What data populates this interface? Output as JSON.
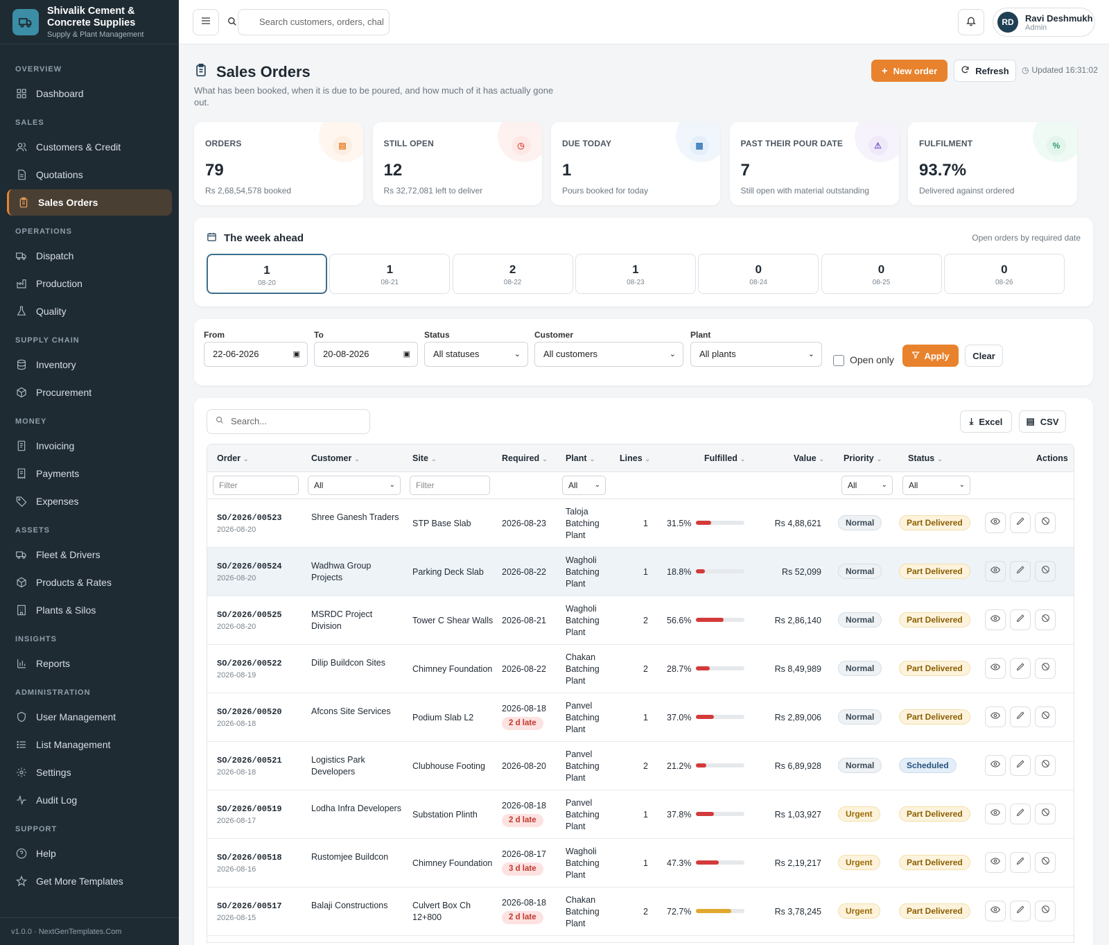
{
  "brand": {
    "title_line1": "Shivalik Cement &",
    "title_line2": "Concrete Supplies",
    "subtitle": "Supply & Plant Management"
  },
  "nav": {
    "sections": [
      {
        "label": "OVERVIEW",
        "items": [
          {
            "label": "Dashboard",
            "icon": "grid-icon"
          }
        ]
      },
      {
        "label": "SALES",
        "items": [
          {
            "label": "Customers & Credit",
            "icon": "users-icon"
          },
          {
            "label": "Quotations",
            "icon": "file-icon"
          },
          {
            "label": "Sales Orders",
            "icon": "clipboard-icon",
            "active": true
          }
        ]
      },
      {
        "label": "OPERATIONS",
        "items": [
          {
            "label": "Dispatch",
            "icon": "truck-icon"
          },
          {
            "label": "Production",
            "icon": "factory-icon"
          },
          {
            "label": "Quality",
            "icon": "flask-icon"
          }
        ]
      },
      {
        "label": "SUPPLY CHAIN",
        "items": [
          {
            "label": "Inventory",
            "icon": "database-icon"
          },
          {
            "label": "Procurement",
            "icon": "box-icon"
          }
        ]
      },
      {
        "label": "MONEY",
        "items": [
          {
            "label": "Invoicing",
            "icon": "invoice-icon"
          },
          {
            "label": "Payments",
            "icon": "receipt-icon"
          },
          {
            "label": "Expenses",
            "icon": "tag-icon"
          }
        ]
      },
      {
        "label": "ASSETS",
        "items": [
          {
            "label": "Fleet & Drivers",
            "icon": "truck-icon"
          },
          {
            "label": "Products & Rates",
            "icon": "box-icon"
          },
          {
            "label": "Plants & Silos",
            "icon": "building-icon"
          }
        ]
      },
      {
        "label": "INSIGHTS",
        "items": [
          {
            "label": "Reports",
            "icon": "bar-chart-icon"
          }
        ]
      },
      {
        "label": "ADMINISTRATION",
        "items": [
          {
            "label": "User Management",
            "icon": "shield-icon"
          },
          {
            "label": "List Management",
            "icon": "list-icon"
          },
          {
            "label": "Settings",
            "icon": "gear-icon"
          },
          {
            "label": "Audit Log",
            "icon": "activity-icon"
          }
        ]
      },
      {
        "label": "SUPPORT",
        "items": [
          {
            "label": "Help",
            "icon": "help-icon"
          },
          {
            "label": "Get More Templates",
            "icon": "star-icon"
          }
        ]
      }
    ],
    "version": "v1.0.0 · NextGenTemplates.Com"
  },
  "topbar": {
    "search_placeholder": "Search customers, orders, chal",
    "user": {
      "initials": "RD",
      "name": "Ravi Deshmukh",
      "role": "Admin"
    }
  },
  "header": {
    "title": "Sales Orders",
    "subtitle": "What has been booked, when it is due to be poured, and how much of it has actually gone out.",
    "new_order": "New order",
    "refresh": "Refresh",
    "updated": "Updated 16:31:02"
  },
  "kpis": [
    {
      "label": "ORDERS",
      "value": "79",
      "note": "Rs 2,68,54,578 booked",
      "color": "#e8822c",
      "bg": "#fdeee2",
      "icon": "clipboard-icon"
    },
    {
      "label": "STILL OPEN",
      "value": "12",
      "note": "Rs 32,72,081 left to deliver",
      "color": "#e0554b",
      "bg": "#fde8e6",
      "icon": "clock-icon"
    },
    {
      "label": "DUE TODAY",
      "value": "1",
      "note": "Pours booked for today",
      "color": "#3c7dbb",
      "bg": "#e5effa",
      "icon": "calendar-icon"
    },
    {
      "label": "PAST THEIR POUR DATE",
      "value": "7",
      "note": "Still open with material outstanding",
      "color": "#7b58c4",
      "bg": "#efe9fa",
      "icon": "alert-icon"
    },
    {
      "label": "FULFILMENT",
      "value": "93.7%",
      "note": "Delivered against ordered",
      "color": "#2e9e6a",
      "bg": "#e3f5ec",
      "icon": "percent-icon"
    }
  ],
  "week": {
    "title": "The week ahead",
    "note": "Open orders by required date",
    "days": [
      {
        "count": "1",
        "date": "08-20",
        "selected": true
      },
      {
        "count": "1",
        "date": "08-21"
      },
      {
        "count": "2",
        "date": "08-22"
      },
      {
        "count": "1",
        "date": "08-23"
      },
      {
        "count": "0",
        "date": "08-24"
      },
      {
        "count": "0",
        "date": "08-25"
      },
      {
        "count": "0",
        "date": "08-26"
      }
    ]
  },
  "filters": {
    "from_label": "From",
    "from": "22-06-2026",
    "to_label": "To",
    "to": "20-08-2026",
    "status_label": "Status",
    "status": "All statuses",
    "customer_label": "Customer",
    "customer": "All customers",
    "plant_label": "Plant",
    "plant": "All plants",
    "open_only": "Open only",
    "apply": "Apply",
    "clear": "Clear"
  },
  "table": {
    "search_placeholder": "Search...",
    "excel": "Excel",
    "csv": "CSV",
    "columns": {
      "order": "Order",
      "customer": "Customer",
      "site": "Site",
      "required": "Required",
      "plant": "Plant",
      "lines": "Lines",
      "fulfilled": "Fulfilled",
      "value": "Value",
      "priority": "Priority",
      "status": "Status",
      "actions": "Actions"
    },
    "filter_row": {
      "order": "Filter",
      "customer": "All",
      "site": "Filter",
      "plant": "All",
      "priority": "All",
      "status": "All"
    },
    "rows": [
      {
        "order": "SO/2026/00523",
        "date": "2026-08-20",
        "customer": "Shree Ganesh Traders",
        "site": "STP Base Slab",
        "required": "2026-08-23",
        "late": "",
        "plant": "Taloja Batching Plant",
        "lines": "1",
        "fulfilled": "31.5%",
        "pct": 31.5,
        "value": "Rs 4,88,621",
        "priority": "Normal",
        "status": "Part Delivered"
      },
      {
        "order": "SO/2026/00524",
        "date": "2026-08-20",
        "customer": "Wadhwa Group Projects",
        "site": "Parking Deck Slab",
        "required": "2026-08-22",
        "late": "",
        "plant": "Wagholi Batching Plant",
        "lines": "1",
        "fulfilled": "18.8%",
        "pct": 18.8,
        "value": "Rs 52,099",
        "priority": "Normal",
        "status": "Part Delivered",
        "highlight": true
      },
      {
        "order": "SO/2026/00525",
        "date": "2026-08-20",
        "customer": "MSRDC Project Division",
        "site": "Tower C Shear Walls",
        "required": "2026-08-21",
        "late": "",
        "plant": "Wagholi Batching Plant",
        "lines": "2",
        "fulfilled": "56.6%",
        "pct": 56.6,
        "value": "Rs 2,86,140",
        "priority": "Normal",
        "status": "Part Delivered"
      },
      {
        "order": "SO/2026/00522",
        "date": "2026-08-19",
        "customer": "Dilip Buildcon Sites",
        "site": "Chimney Foundation",
        "required": "2026-08-22",
        "late": "",
        "plant": "Chakan Batching Plant",
        "lines": "2",
        "fulfilled": "28.7%",
        "pct": 28.7,
        "value": "Rs 8,49,989",
        "priority": "Normal",
        "status": "Part Delivered"
      },
      {
        "order": "SO/2026/00520",
        "date": "2026-08-18",
        "customer": "Afcons Site Services",
        "site": "Podium Slab L2",
        "required": "2026-08-18",
        "late": "2 d late",
        "plant": "Panvel Batching Plant",
        "lines": "1",
        "fulfilled": "37.0%",
        "pct": 37.0,
        "value": "Rs 2,89,006",
        "priority": "Normal",
        "status": "Part Delivered"
      },
      {
        "order": "SO/2026/00521",
        "date": "2026-08-18",
        "customer": "Logistics Park Developers",
        "site": "Clubhouse Footing",
        "required": "2026-08-20",
        "late": "",
        "plant": "Panvel Batching Plant",
        "lines": "2",
        "fulfilled": "21.2%",
        "pct": 21.2,
        "value": "Rs 6,89,928",
        "priority": "Normal",
        "status": "Scheduled"
      },
      {
        "order": "SO/2026/00519",
        "date": "2026-08-17",
        "customer": "Lodha Infra Developers",
        "site": "Substation Plinth",
        "required": "2026-08-18",
        "late": "2 d late",
        "plant": "Panvel Batching Plant",
        "lines": "1",
        "fulfilled": "37.8%",
        "pct": 37.8,
        "value": "Rs 1,03,927",
        "priority": "Urgent",
        "status": "Part Delivered"
      },
      {
        "order": "SO/2026/00518",
        "date": "2026-08-16",
        "customer": "Rustomjee Buildcon",
        "site": "Chimney Foundation",
        "required": "2026-08-17",
        "late": "3 d late",
        "plant": "Wagholi Batching Plant",
        "lines": "1",
        "fulfilled": "47.3%",
        "pct": 47.3,
        "value": "Rs 2,19,217",
        "priority": "Urgent",
        "status": "Part Delivered"
      },
      {
        "order": "SO/2026/00517",
        "date": "2026-08-15",
        "customer": "Balaji Constructions",
        "site": "Culvert Box Ch 12+800",
        "required": "2026-08-18",
        "late": "2 d late",
        "plant": "Chakan Batching Plant",
        "lines": "2",
        "fulfilled": "72.7%",
        "pct": 72.7,
        "value": "Rs 3,78,245",
        "priority": "Urgent",
        "status": "Part Delivered"
      }
    ]
  },
  "colors": {
    "accent": "#e8822c",
    "bar_red": "#d33b3b",
    "bar_amber": "#e0a82e"
  }
}
